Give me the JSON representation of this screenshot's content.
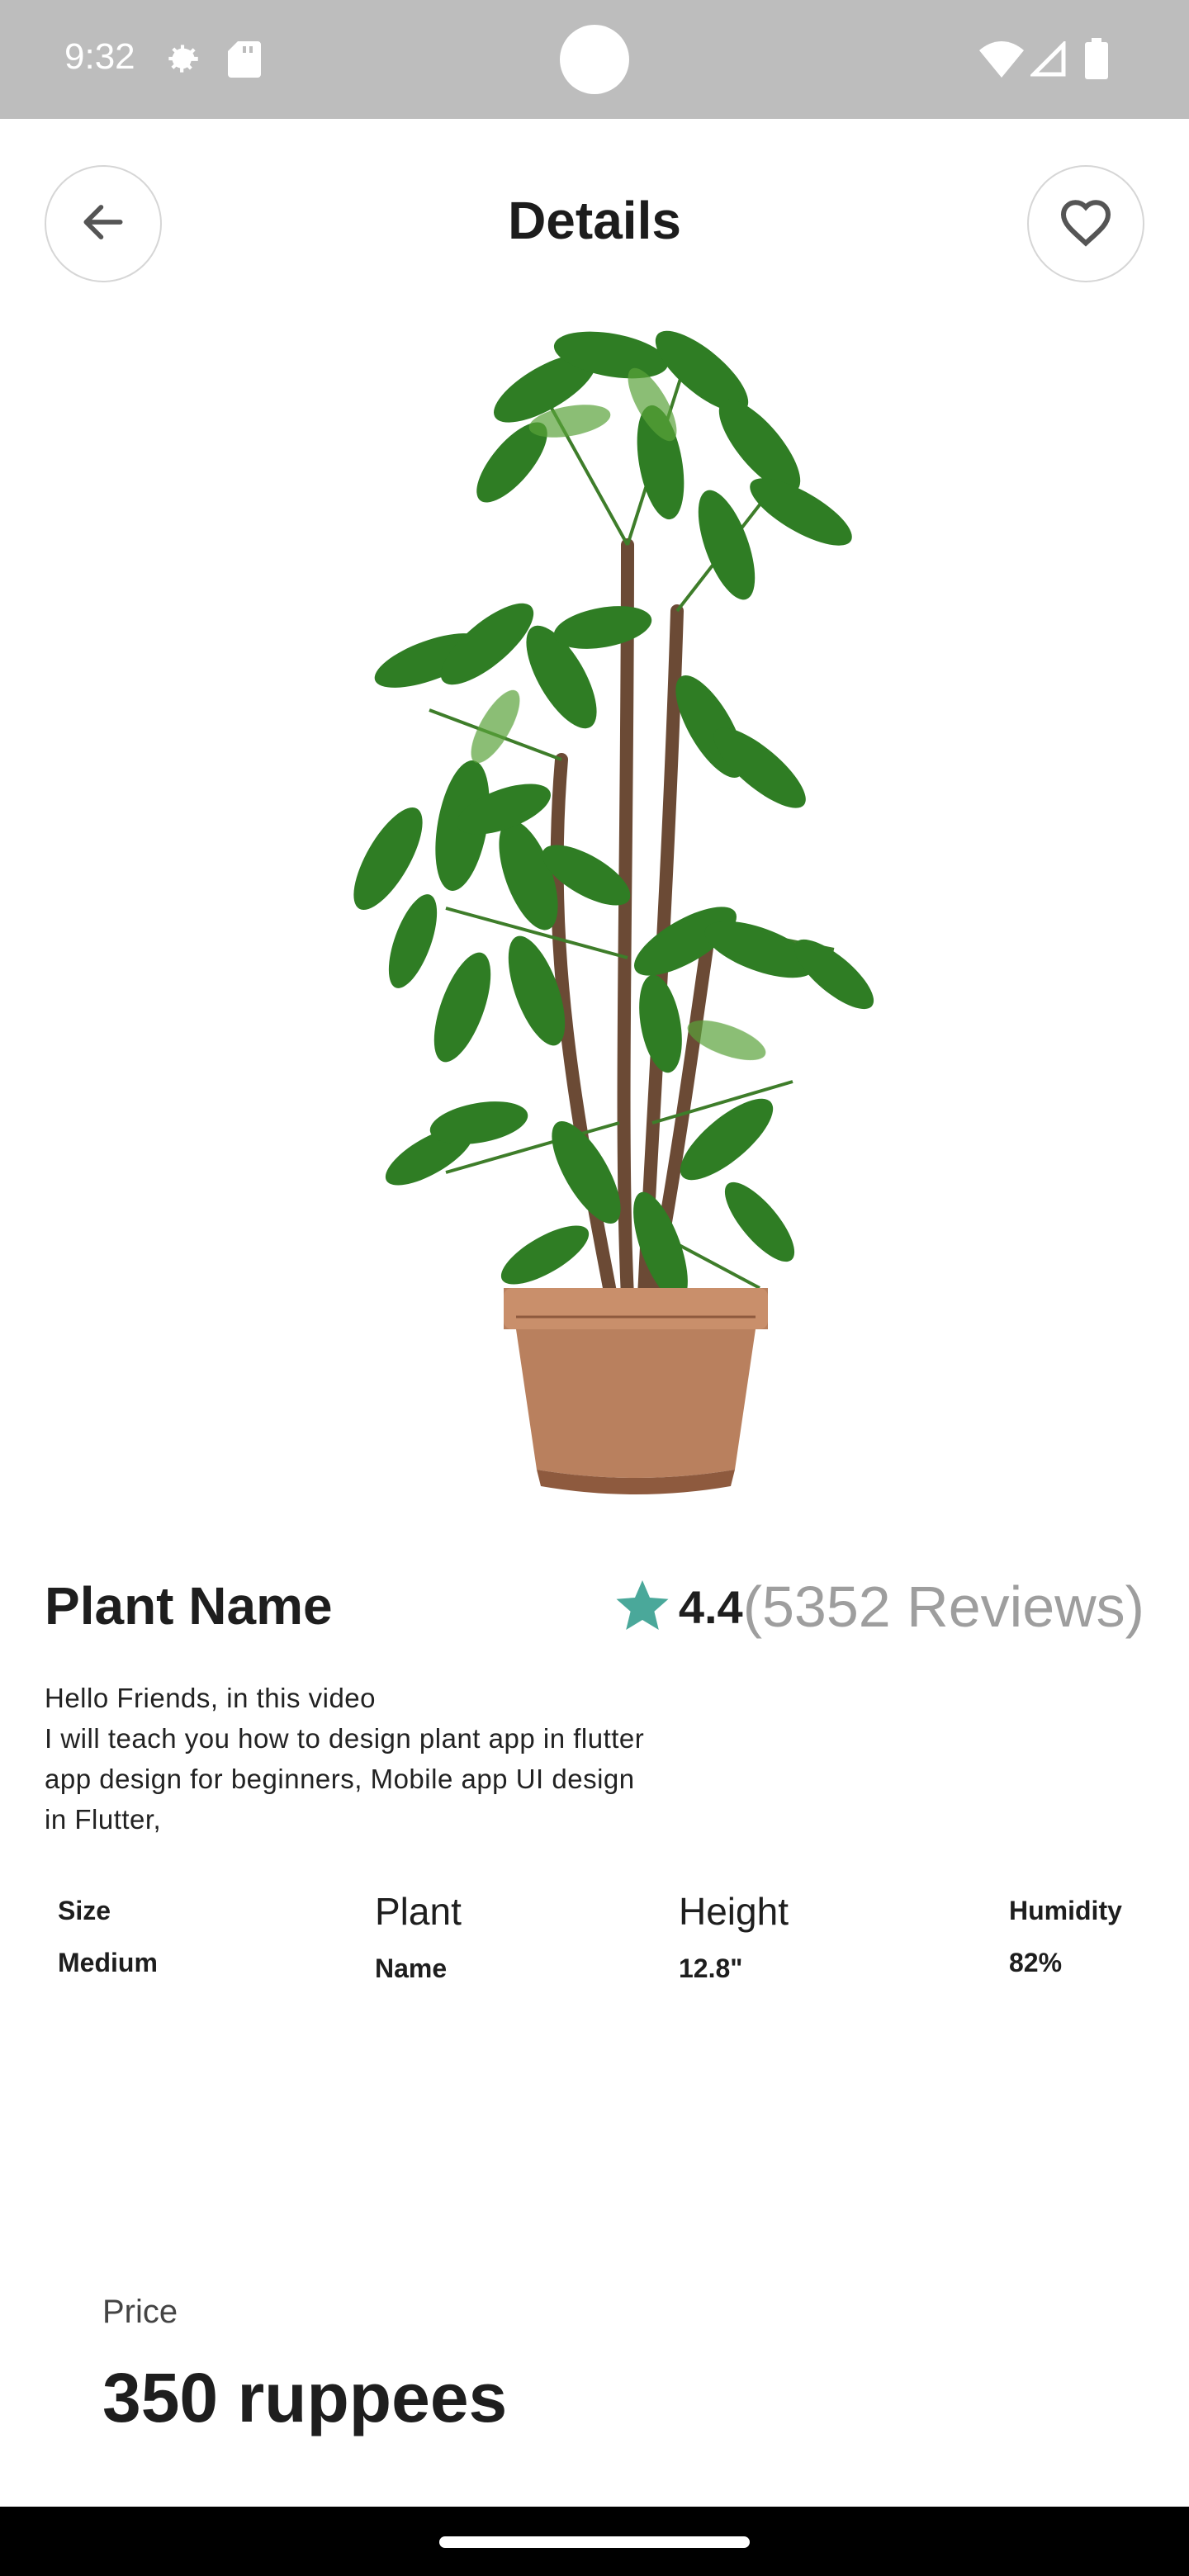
{
  "status_bar": {
    "time": "9:32",
    "icons": [
      "settings-gear-icon",
      "sd-card-icon",
      "wifi-icon",
      "cellular-signal-icon",
      "battery-icon"
    ]
  },
  "header": {
    "title": "Details",
    "back_icon": "arrow-left-icon",
    "favorite_icon": "heart-outline-icon"
  },
  "product": {
    "name": "Plant Name",
    "rating": "4.4",
    "reviews": "(5352 Reviews)",
    "star_color": "#4aa89a",
    "description": "Hello Friends, in this video\nI will teach you how to design plant app in flutter\napp design for beginners, Mobile app UI design\nin Flutter,"
  },
  "specs": [
    {
      "label": "Size",
      "value": "Medium"
    },
    {
      "label": "Plant",
      "value": "Name"
    },
    {
      "label": "Height",
      "value": "12.8\""
    },
    {
      "label": "Humidity",
      "value": "82%"
    }
  ],
  "price": {
    "label": "Price",
    "value": "350 ruppees"
  },
  "colors": {
    "status_bar_bg": "#bdbdbd",
    "accent_star": "#4aa89a",
    "muted_text": "#9e9e9e"
  }
}
